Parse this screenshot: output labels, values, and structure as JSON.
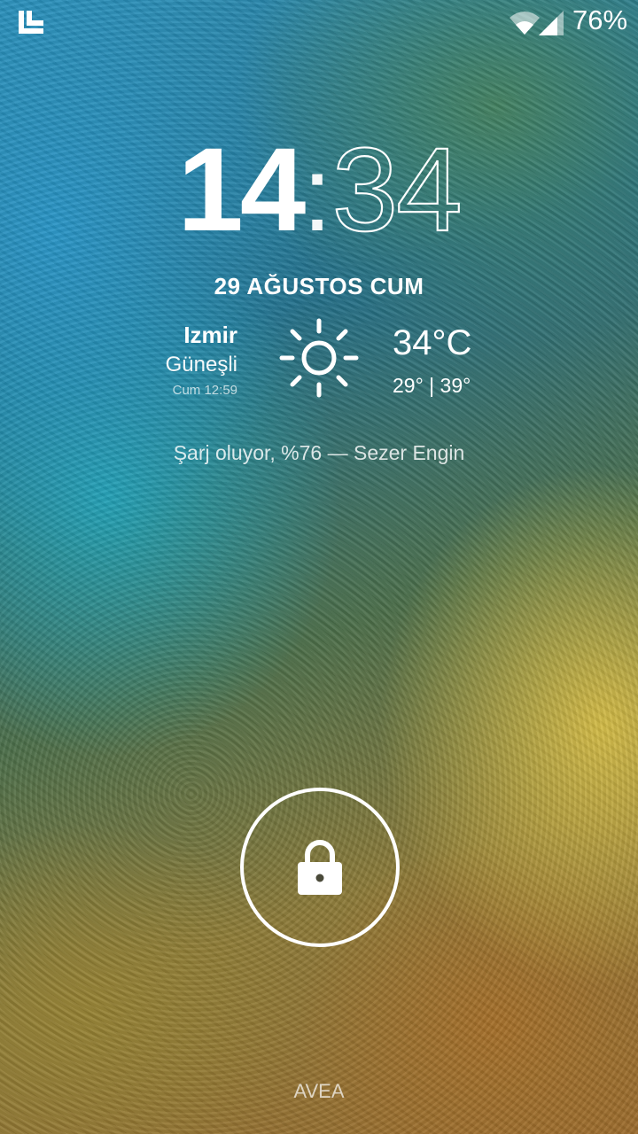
{
  "status_bar": {
    "battery_percent": "76%",
    "icons": [
      "app-logo-icon",
      "wifi-icon",
      "signal-icon"
    ]
  },
  "clock": {
    "hours": "14",
    "separator": ":",
    "minutes": "34"
  },
  "date": "29 AĞUSTOS CUM",
  "weather": {
    "city": "Izmir",
    "condition": "Güneşli",
    "updated": "Cum 12:59",
    "icon": "sun-icon",
    "temperature": "34°C",
    "range": "29° | 39°"
  },
  "charging_status": "Şarj oluyor, %76 — Sezer Engin",
  "lock": {
    "icon": "lock-icon"
  },
  "carrier": "AVEA"
}
